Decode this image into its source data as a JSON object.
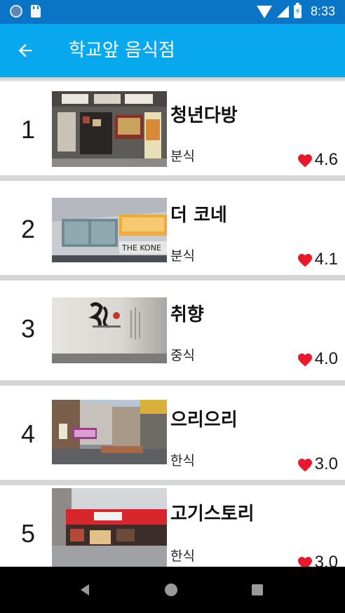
{
  "status_bar": {
    "time": "8:33",
    "icons": [
      "notification-circle-icon",
      "sd-card-icon",
      "wifi-icon",
      "signal-icon",
      "battery-charging-icon"
    ]
  },
  "app_bar": {
    "back_icon": "arrow-left-icon",
    "title": "학교앞 음식점"
  },
  "restaurants": [
    {
      "rank": "1",
      "name": "청년다방",
      "category": "분식",
      "rating": "4.6",
      "photo": "storefront-photo"
    },
    {
      "rank": "2",
      "name": "더 코네",
      "category": "분식",
      "rating": "4.1",
      "photo": "storefront-photo"
    },
    {
      "rank": "3",
      "name": "취향",
      "category": "중식",
      "rating": "4.0",
      "photo": "interior-wall-photo"
    },
    {
      "rank": "4",
      "name": "으리으리",
      "category": "한식",
      "rating": "3.0",
      "photo": "street-photo"
    },
    {
      "rank": "5",
      "name": "고기스토리",
      "category": "한식",
      "rating": "3.0",
      "photo": "storefront-photo"
    }
  ],
  "colors": {
    "status_bar": "#0a74c6",
    "app_bar": "#07a8ee",
    "heart": "#e8192c",
    "divider": "#d6d6d6"
  },
  "nav_bar": {
    "icons": [
      "back-triangle-icon",
      "home-circle-icon",
      "recents-square-icon"
    ]
  }
}
